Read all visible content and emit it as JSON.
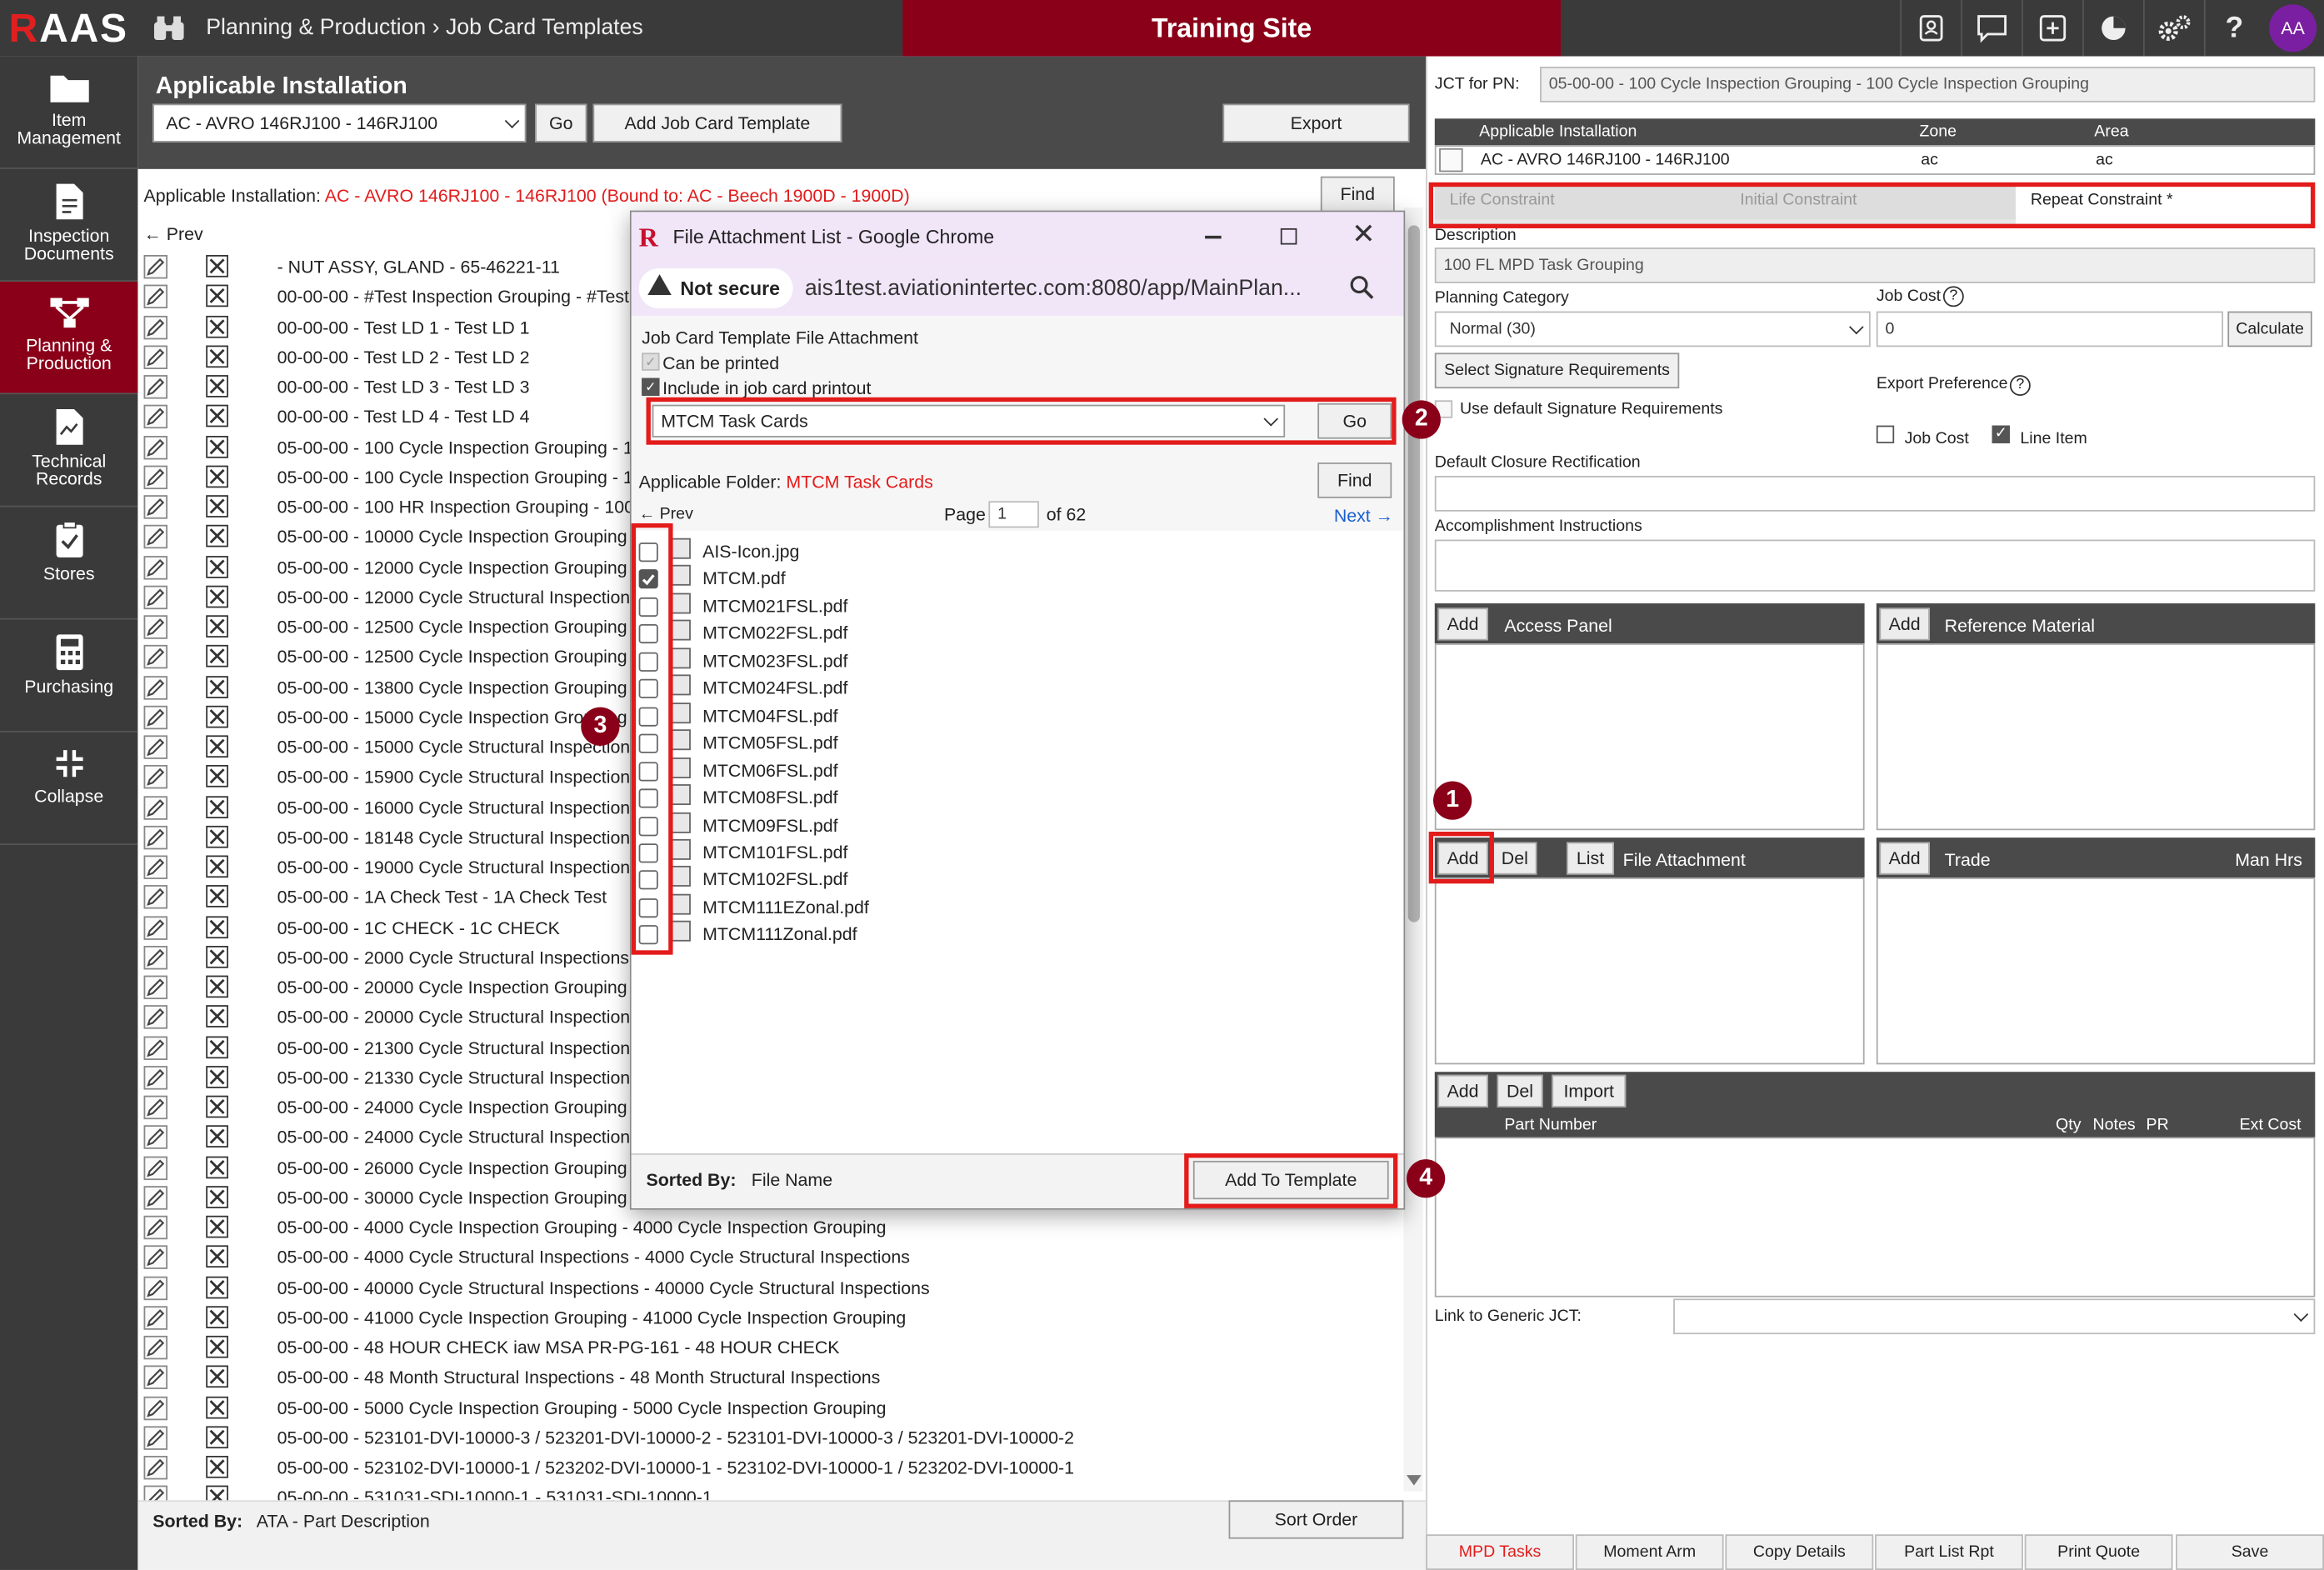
{
  "app": {
    "logo_r": "R",
    "logo_rest": "AAS",
    "breadcrumb": "Planning & Production › Job Card Templates",
    "site_banner": "Training Site",
    "avatar_initials": "AA",
    "accent_color": "#8b0019"
  },
  "topbar_icons": [
    "contact-card-icon",
    "chat-icon",
    "plus-box-icon",
    "pie-chart-icon",
    "gears-icon",
    "help-icon"
  ],
  "sidebar": {
    "items": [
      {
        "label1": "Item",
        "label2": "Management",
        "icon": "folder-icon"
      },
      {
        "label1": "Inspection",
        "label2": "Documents",
        "icon": "document-icon"
      },
      {
        "label1": "Planning &",
        "label2": "Production",
        "icon": "flow-icon",
        "active": true
      },
      {
        "label1": "Technical",
        "label2": "Records",
        "icon": "records-icon"
      },
      {
        "label1": "Stores",
        "label2": "",
        "icon": "clipboard-check-icon"
      },
      {
        "label1": "Purchasing",
        "label2": "",
        "icon": "calculator-icon"
      },
      {
        "label1": "Collapse",
        "label2": "",
        "icon": "collapse-icon"
      }
    ]
  },
  "left": {
    "section_title": "Applicable Installation",
    "installation_select": "AC - AVRO 146RJ100 - 146RJ100",
    "go_label": "Go",
    "add_template_label": "Add Job Card Template",
    "export_label": "Export",
    "applicable_label": "Applicable Installation:",
    "applicable_value": "AC - AVRO 146RJ100 - 146RJ100 (Bound to: AC - Beech 1900D - 1900D)",
    "find_label": "Find",
    "prev_label": "← Prev",
    "rows": [
      " - NUT ASSY, GLAND - 65-46221-11",
      "00-00-00 - #Test Inspection Grouping - #Test Inspection Grouping",
      "00-00-00 - Test LD 1 - Test LD 1",
      "00-00-00 - Test LD 2 - Test LD 2",
      "00-00-00 - Test LD 3 - Test LD 3",
      "00-00-00 - Test LD 4 - Test LD 4",
      "05-00-00 - 100 Cycle Inspection Grouping - 100 Cycle Inspection Grouping",
      "05-00-00 - 100 Cycle Inspection Grouping - 100 Cycle Inspection Grouping",
      "05-00-00 - 100 HR Inspection Grouping - 100 HR Inspection Grouping",
      "05-00-00 - 10000 Cycle Inspection Grouping - 10000 Cycle Inspection Grouping",
      "05-00-00 - 12000 Cycle Inspection Grouping - 12000 Cycle Inspection Grouping",
      "05-00-00 - 12000 Cycle Structural Inspections - 12000 Cycle Structural Inspections",
      "05-00-00 - 12500 Cycle Inspection Grouping - 12500 Cycle Inspection Grouping",
      "05-00-00 - 12500 Cycle Inspection Grouping - 12500 Cycle Inspection Grouping",
      "05-00-00 - 13800 Cycle Inspection Grouping - 13800 Cycle Inspection Grouping",
      "05-00-00 - 15000 Cycle Inspection Grouping - 15000 Cycle Inspection Grouping",
      "05-00-00 - 15000 Cycle Structural Inspections - 15000 Cycle Structural Inspections",
      "05-00-00 - 15900 Cycle Structural Inspections - 15900 Cycle Structural Inspections",
      "05-00-00 - 16000 Cycle Structural Inspections - 16000 Cycle Structural Inspections",
      "05-00-00 - 18148 Cycle Structural Inspections - 18148 Cycle Structural Inspections",
      "05-00-00 - 19000 Cycle Structural Inspections - 19000 Cycle Structural Inspections",
      "05-00-00 - 1A Check Test - 1A Check Test",
      "05-00-00 - 1C CHECK - 1C CHECK",
      "05-00-00 - 2000 Cycle Structural Inspections - 2000 Cycle Structural Inspections",
      "05-00-00 - 20000 Cycle Inspection Grouping - 20000 Cycle Inspection Grouping",
      "05-00-00 - 20000 Cycle Structural Inspections - 20000 Cycle Structural Inspections",
      "05-00-00 - 21300 Cycle Structural Inspections - 21300 Cycle Structural Inspections",
      "05-00-00 - 21330 Cycle Structural Inspections - 21330 Cycle Structural Inspections",
      "05-00-00 - 24000 Cycle Inspection Grouping - 24000 Cycle Inspection Grouping",
      "05-00-00 - 24000 Cycle Structural Inspections - 24000 Cycle Structural Inspections",
      "05-00-00 - 26000 Cycle Inspection Grouping - 26000 Cycle Inspection Grouping",
      "05-00-00 - 30000 Cycle Inspection Grouping - 30000 Cycle Inspection Grouping",
      "05-00-00 - 4000 Cycle Inspection Grouping - 4000 Cycle Inspection Grouping",
      "05-00-00 - 4000 Cycle Structural Inspections - 4000 Cycle Structural Inspections",
      "05-00-00 - 40000 Cycle Structural Inspections - 40000 Cycle Structural Inspections",
      "05-00-00 - 41000 Cycle Inspection Grouping - 41000 Cycle Inspection Grouping",
      "05-00-00 - 48 HOUR CHECK iaw MSA PR-PG-161 - 48 HOUR CHECK",
      "05-00-00 - 48 Month Structural Inspections - 48 Month Structural Inspections",
      "05-00-00 - 5000 Cycle Inspection Grouping - 5000 Cycle Inspection Grouping",
      "05-00-00 - 523101-DVI-10000-3 / 523201-DVI-10000-2 - 523101-DVI-10000-3 / 523201-DVI-10000-2",
      "05-00-00 - 523102-DVI-10000-1 / 523202-DVI-10000-1 - 523102-DVI-10000-1 / 523202-DVI-10000-1",
      "05-00-00 - 531031-SDI-10000-1 - 531031-SDI-10000-1"
    ],
    "sorted_by_label": "Sorted By:",
    "sorted_by_value": "ATA - Part Description",
    "sort_order_label": "Sort Order"
  },
  "dialog": {
    "title": "File Attachment List - Google Chrome",
    "not_secure": "Not secure",
    "url": "ais1test.aviationintertec.com:8080/app/MainPlan...",
    "heading": "Job Card Template File Attachment",
    "can_print_label": "Can be printed",
    "include_label": "Include in job card printout",
    "folder_select": "MTCM Task Cards",
    "go_label": "Go",
    "applicable_folder_label": "Applicable Folder:",
    "applicable_folder_value": "MTCM Task Cards",
    "find_label": "Find",
    "prev_label": "← Prev",
    "page_label": "Page",
    "page_value": "1",
    "of_label": "of 62",
    "next_label": "Next →",
    "files": [
      {
        "name": "AIS-Icon.jpg",
        "checked": false
      },
      {
        "name": "MTCM.pdf",
        "checked": true
      },
      {
        "name": "MTCM021FSL.pdf",
        "checked": false
      },
      {
        "name": "MTCM022FSL.pdf",
        "checked": false
      },
      {
        "name": "MTCM023FSL.pdf",
        "checked": false
      },
      {
        "name": "MTCM024FSL.pdf",
        "checked": false
      },
      {
        "name": "MTCM04FSL.pdf",
        "checked": false
      },
      {
        "name": "MTCM05FSL.pdf",
        "checked": false
      },
      {
        "name": "MTCM06FSL.pdf",
        "checked": false
      },
      {
        "name": "MTCM08FSL.pdf",
        "checked": false
      },
      {
        "name": "MTCM09FSL.pdf",
        "checked": false
      },
      {
        "name": "MTCM101FSL.pdf",
        "checked": false
      },
      {
        "name": "MTCM102FSL.pdf",
        "checked": false
      },
      {
        "name": "MTCM111EZonal.pdf",
        "checked": false
      },
      {
        "name": "MTCM111Zonal.pdf",
        "checked": false
      }
    ],
    "sorted_by_label": "Sorted By:",
    "sorted_by_value": "File Name",
    "add_to_template_label": "Add To Template"
  },
  "right": {
    "jct_label": "JCT for PN:",
    "jct_value": "05-00-00 - 100 Cycle Inspection Grouping - 100 Cycle Inspection Grouping",
    "table_headers": [
      "Applicable Installation",
      "Zone",
      "Area"
    ],
    "table_row": [
      "AC - AVRO 146RJ100 - 146RJ100",
      "ac",
      "ac"
    ],
    "tabs": [
      "Life Constraint",
      "Initial Constraint",
      "Repeat Constraint *"
    ],
    "description_label": "Description",
    "description_value": "100 FL MPD Task Grouping",
    "planning_category_label": "Planning Category",
    "planning_category_value": "Normal (30)",
    "job_cost_label": "Job Cost",
    "job_cost_value": "0",
    "calculate_label": "Calculate",
    "select_sig_label": "Select Signature Requirements",
    "export_pref_label": "Export Preference",
    "use_default_label": "Use default Signature Requirements",
    "job_cost_cb_label": "Job Cost",
    "line_item_label": "Line Item",
    "default_closure_label": "Default Closure Rectification",
    "accomplishment_label": "Accomplishment Instructions",
    "add_label": "Add",
    "del_label": "Del",
    "list_label": "List",
    "import_label": "Import",
    "access_panel_label": "Access Panel",
    "reference_material_label": "Reference Material",
    "file_attachment_label": "File Attachment",
    "trade_label": "Trade",
    "man_hrs_label": "Man Hrs",
    "part_number_label": "Part Number",
    "qty_label": "Qty",
    "notes_label": "Notes",
    "pr_label": "PR",
    "ext_cost_label": "Ext Cost",
    "link_generic_label": "Link to Generic JCT:",
    "bottom_tabs": [
      "MPD Tasks",
      "Moment Arm",
      "Copy Details",
      "Part List Rpt",
      "Print Quote",
      "Save"
    ]
  },
  "callouts": [
    "1",
    "2",
    "3",
    "4"
  ]
}
